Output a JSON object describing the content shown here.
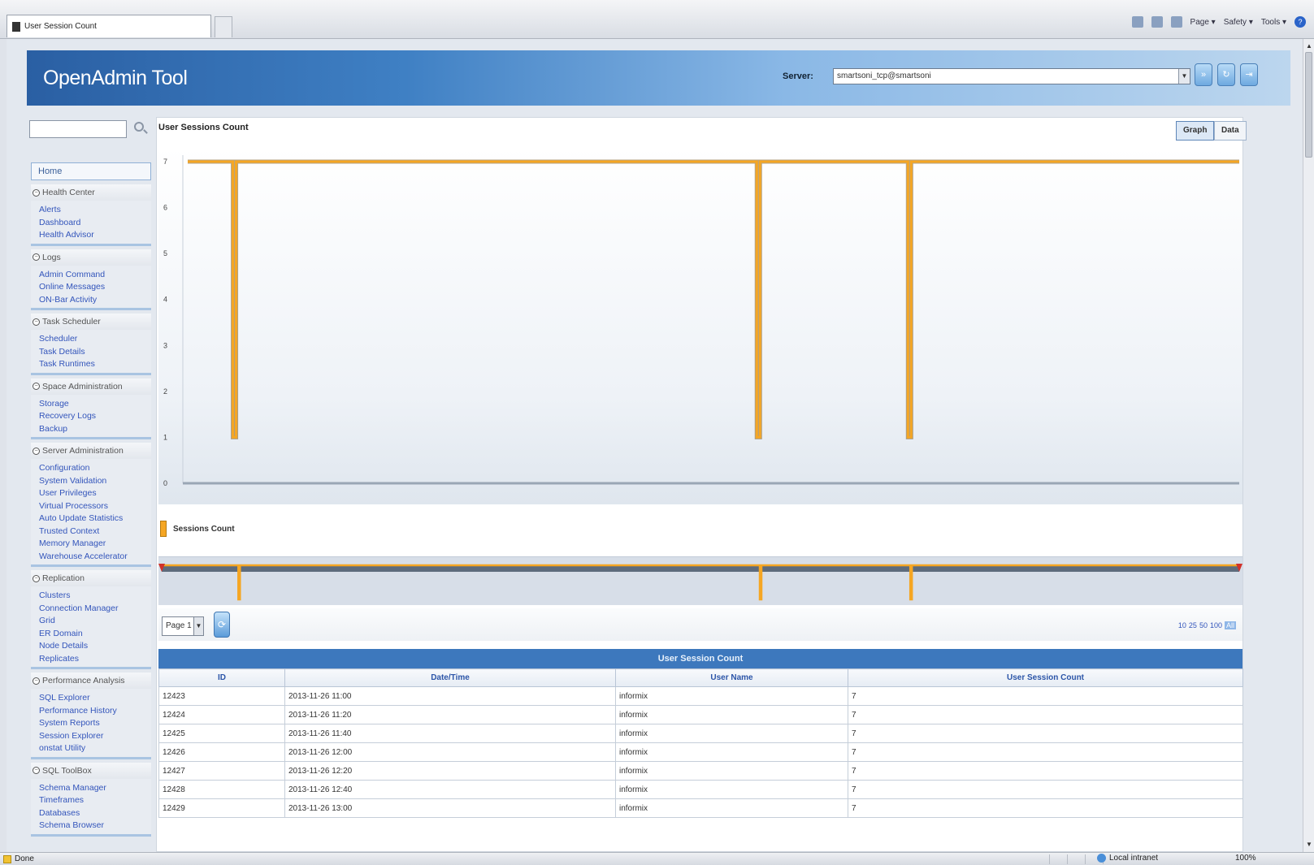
{
  "browser": {
    "tab_title": "User Session Count",
    "commands": [
      "Page ▾",
      "Safety ▾",
      "Tools ▾"
    ],
    "status_text": "Done",
    "zone": "Local intranet",
    "zoom": "100%"
  },
  "header": {
    "logo": "OpenAdmin Tool",
    "server_label": "Server:",
    "server_value": "smartsoni_tcp@smartsoni"
  },
  "sidebar": {
    "home": "Home",
    "groups": [
      {
        "title": "Health Center",
        "items": [
          "Alerts",
          "Dashboard",
          "Health Advisor"
        ]
      },
      {
        "title": "Logs",
        "items": [
          "Admin Command",
          "Online Messages",
          "ON-Bar Activity"
        ]
      },
      {
        "title": "Task Scheduler",
        "items": [
          "Scheduler",
          "Task Details",
          "Task Runtimes"
        ]
      },
      {
        "title": "Space Administration",
        "items": [
          "Storage",
          "Recovery Logs",
          "Backup"
        ]
      },
      {
        "title": "Server Administration",
        "items": [
          "Configuration",
          "System Validation",
          "User Privileges",
          "Virtual Processors",
          "Auto Update Statistics",
          "Trusted Context",
          "Memory Manager",
          "Warehouse Accelerator"
        ]
      },
      {
        "title": "Replication",
        "items": [
          "Clusters",
          "Connection Manager",
          "Grid",
          "ER Domain",
          "Node Details",
          "Replicates"
        ]
      },
      {
        "title": "Performance Analysis",
        "items": [
          "SQL Explorer",
          "Performance History",
          "System Reports",
          "Session Explorer",
          "onstat Utility"
        ]
      },
      {
        "title": "SQL ToolBox",
        "items": [
          "Schema Manager",
          "Timeframes",
          "Databases",
          "Schema Browser"
        ]
      }
    ]
  },
  "panel": {
    "title": "User Sessions Count",
    "tabs": [
      "Graph",
      "Data"
    ],
    "page_select": "Page 1",
    "page_sizes": [
      "10",
      "25",
      "50",
      "100",
      "All"
    ]
  },
  "chart_data": {
    "type": "line",
    "title": "User Sessions Count",
    "legend": [
      "Sessions Count"
    ],
    "legend_position": "bottom-left",
    "y_ticks": [
      "7",
      "6",
      "5",
      "4",
      "3",
      "2",
      "1",
      "0"
    ],
    "ylim": [
      0,
      7
    ],
    "grid": false,
    "series": [
      {
        "name": "Sessions Count",
        "values": [
          7,
          1,
          7,
          7,
          7,
          7,
          7,
          7,
          7,
          7,
          7,
          7,
          7,
          7,
          7,
          7,
          7,
          7,
          7,
          7,
          1,
          7,
          7,
          7,
          7,
          7,
          1,
          7,
          7,
          7,
          7,
          7,
          7,
          7,
          7,
          7,
          7,
          7,
          7,
          7,
          7
        ]
      }
    ],
    "dips_at_fraction": [
      0.043,
      0.542,
      0.686
    ],
    "color": "#f5a623"
  },
  "table": {
    "caption": "User Session Count",
    "columns": [
      "ID",
      "Date/Time",
      "User Name",
      "User Session Count"
    ],
    "rows": [
      [
        "12423",
        "2013-11-26 11:00",
        "informix",
        "7"
      ],
      [
        "12424",
        "2013-11-26 11:20",
        "informix",
        "7"
      ],
      [
        "12425",
        "2013-11-26 11:40",
        "informix",
        "7"
      ],
      [
        "12426",
        "2013-11-26 12:00",
        "informix",
        "7"
      ],
      [
        "12427",
        "2013-11-26 12:20",
        "informix",
        "7"
      ],
      [
        "12428",
        "2013-11-26 12:40",
        "informix",
        "7"
      ],
      [
        "12429",
        "2013-11-26 13:00",
        "informix",
        "7"
      ]
    ]
  }
}
